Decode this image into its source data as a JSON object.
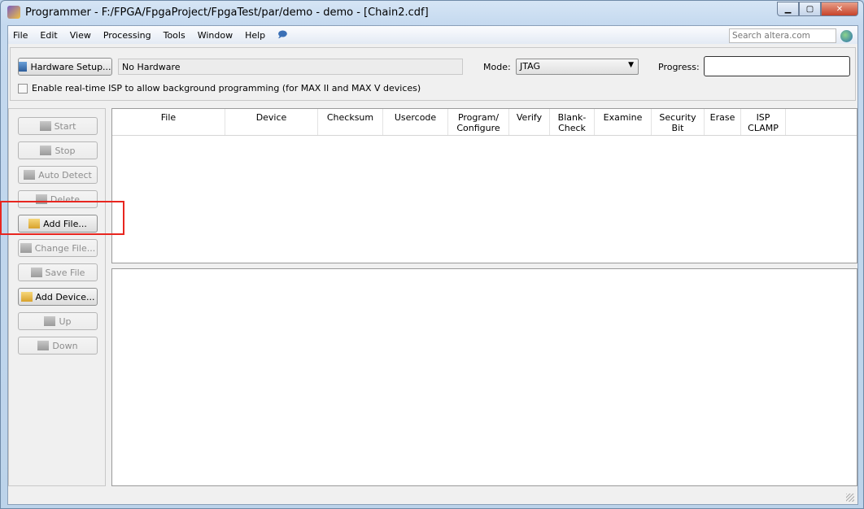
{
  "window": {
    "title": "Programmer - F:/FPGA/FpgaProject/FpgaTest/par/demo - demo - [Chain2.cdf]"
  },
  "menu": [
    "File",
    "Edit",
    "View",
    "Processing",
    "Tools",
    "Window",
    "Help"
  ],
  "search": {
    "placeholder": "Search altera.com"
  },
  "toolbar": {
    "hardware_setup": "Hardware Setup...",
    "hardware_value": "No Hardware",
    "mode_label": "Mode:",
    "mode_value": "JTAG",
    "progress_label": "Progress:",
    "isp_checkbox": "Enable real-time ISP to allow background programming (for MAX II and MAX V devices)",
    "isp_checked": false
  },
  "side_buttons": [
    {
      "label": "Start",
      "enabled": false,
      "icon": "start-icon"
    },
    {
      "label": "Stop",
      "enabled": false,
      "icon": "stop-icon"
    },
    {
      "label": "Auto Detect",
      "enabled": false,
      "icon": "auto-detect-icon"
    },
    {
      "label": "Delete",
      "enabled": false,
      "icon": "delete-icon"
    },
    {
      "label": "Add File...",
      "enabled": true,
      "icon": "folder-icon"
    },
    {
      "label": "Change File...",
      "enabled": false,
      "icon": "change-file-icon"
    },
    {
      "label": "Save File",
      "enabled": false,
      "icon": "save-icon"
    },
    {
      "label": "Add Device...",
      "enabled": true,
      "icon": "add-device-icon"
    },
    {
      "label": "Up",
      "enabled": false,
      "icon": "up-arrow-icon"
    },
    {
      "label": "Down",
      "enabled": false,
      "icon": "down-arrow-icon"
    }
  ],
  "columns": [
    "File",
    "Device",
    "Checksum",
    "Usercode",
    "Program/\nConfigure",
    "Verify",
    "Blank-\nCheck",
    "Examine",
    "Security\nBit",
    "Erase",
    "ISP\nCLAMP"
  ],
  "colors": {
    "highlight": "#e8261f"
  }
}
